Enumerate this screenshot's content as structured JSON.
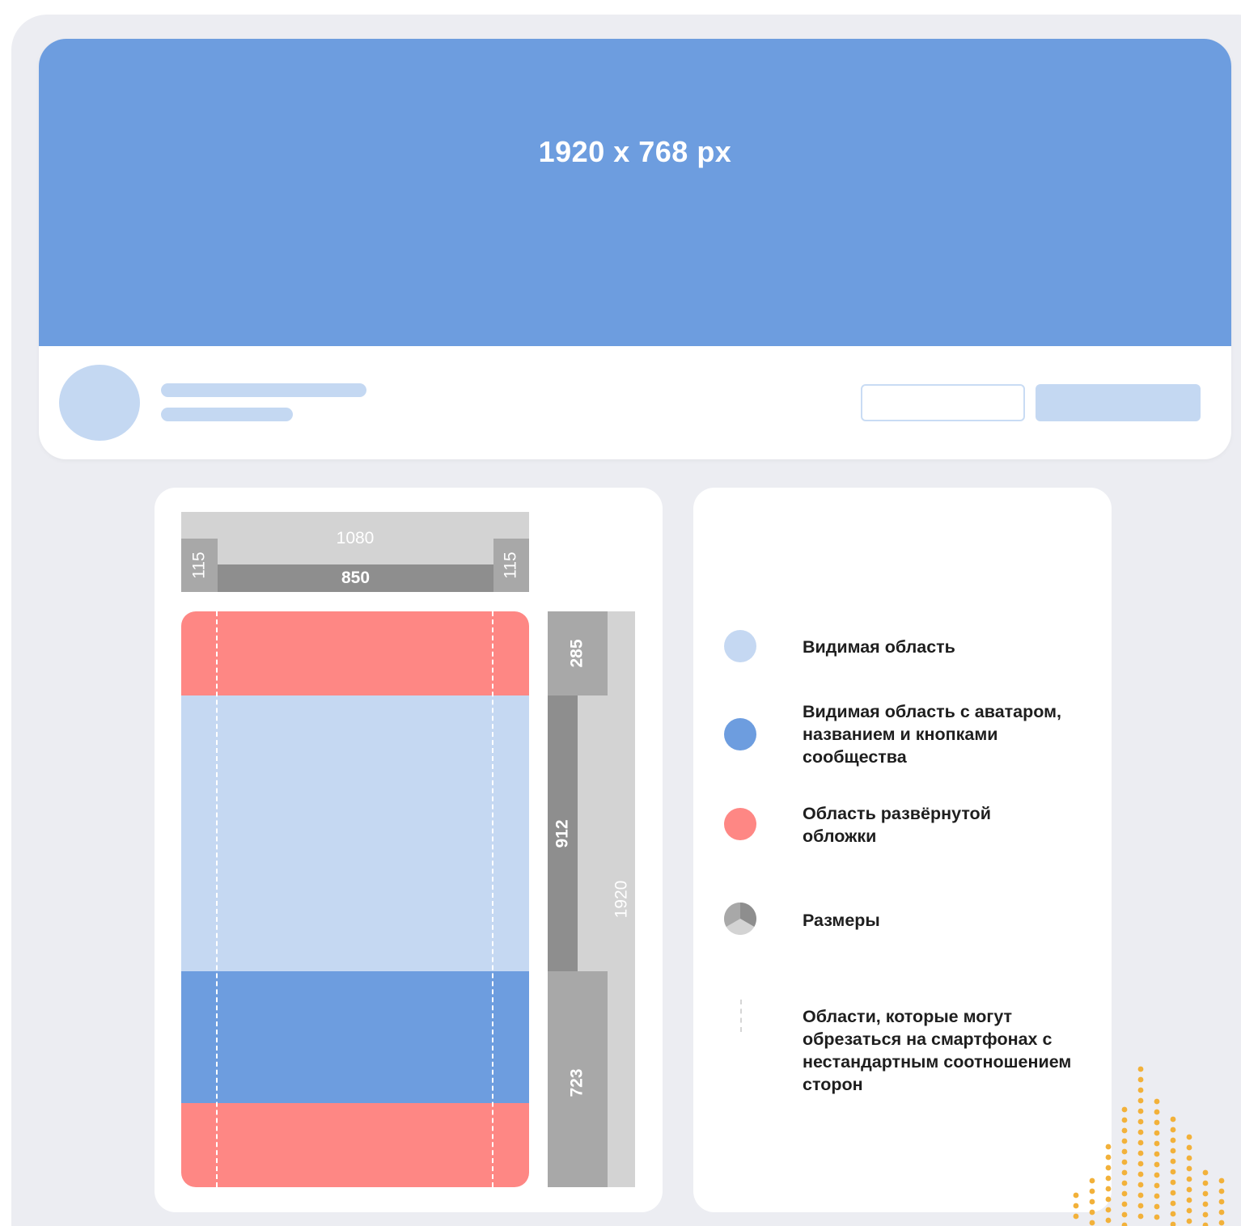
{
  "cover": {
    "size_label": "1920 x 768 px",
    "color": "#6d9ddf"
  },
  "diagram": {
    "width_total": "1080",
    "width_safe": "850",
    "margin_left": "115",
    "margin_right": "115",
    "height_top": "285",
    "height_middle": "912",
    "height_total": "1920",
    "height_bottom": "723"
  },
  "legend": {
    "items": [
      {
        "text": "Видимая область",
        "color": "#c5d8f2"
      },
      {
        "text": "Видимая область с аватаром, названием и кнопками сообщества",
        "color": "#6d9ddf"
      },
      {
        "text": "Область развёрнутой обложки",
        "color": "#fe8784"
      },
      {
        "text": "Размеры",
        "icon": "pie-icon"
      },
      {
        "text": "Области, которые могут обрезаться на смартфонах с нестандартным соотношением сторон",
        "icon": "dashed-line-icon"
      }
    ]
  },
  "colors": {
    "background": "#ecedf2",
    "light_blue": "#c5d8f2",
    "blue": "#6d9ddf",
    "red": "#fe8784",
    "gray_light": "#d3d3d3",
    "gray_mid": "#a8a8a8",
    "gray_dark": "#8e8e8e",
    "dots": "#f2b13a"
  }
}
